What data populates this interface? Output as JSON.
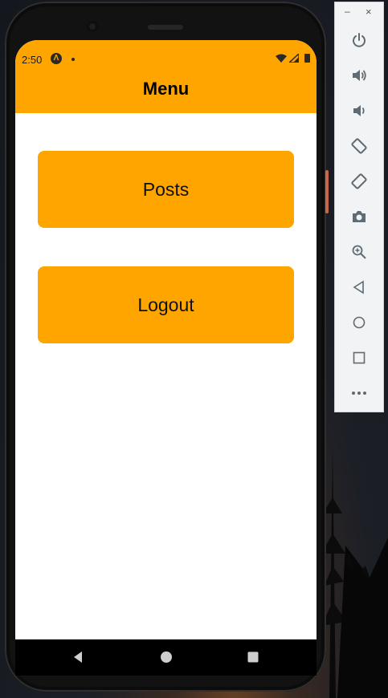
{
  "status_bar": {
    "time": "2:50",
    "app_icon_glyph": "Λ"
  },
  "header": {
    "title": "Menu",
    "background": "#FFA500"
  },
  "menu": {
    "buttons": [
      {
        "label": "Posts"
      },
      {
        "label": "Logout"
      }
    ],
    "button_color": "#FFA500"
  },
  "nav_bar": {
    "icons": [
      "back-icon",
      "home-icon",
      "recents-icon"
    ]
  },
  "emulator_toolbar": {
    "window_controls": {
      "minimize": "–",
      "close": "×"
    },
    "icons": [
      "power-icon",
      "volume-up-icon",
      "volume-down-icon",
      "rotate-left-icon",
      "rotate-right-icon",
      "camera-icon",
      "zoom-icon",
      "back-icon",
      "home-icon",
      "overview-icon",
      "more-icon"
    ]
  }
}
